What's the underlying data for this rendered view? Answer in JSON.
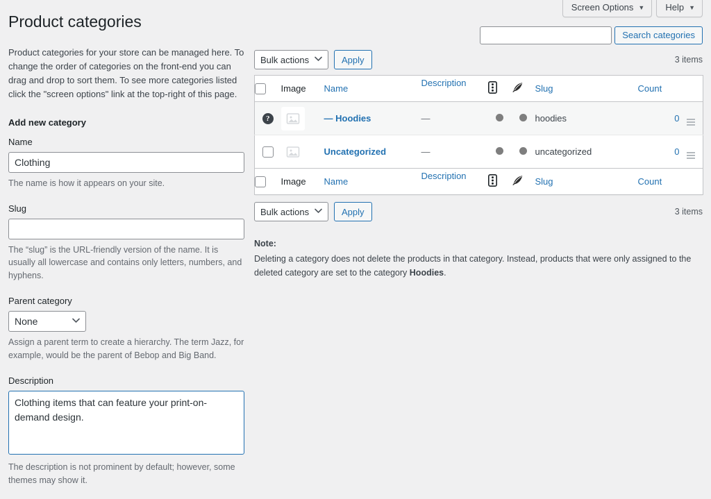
{
  "meta": {
    "screen_options_label": "Screen Options",
    "help_label": "Help",
    "caret_glyph": "▼"
  },
  "header": {
    "page_title": "Product categories"
  },
  "search": {
    "value": "",
    "placeholder": "",
    "button_label": "Search categories"
  },
  "intro": {
    "text": "Product categories for your store can be managed here. To change the order of categories on the front-end you can drag and drop to sort them. To see more categories listed click the \"screen options\" link at the top-right of this page."
  },
  "form": {
    "title": "Add new category",
    "name_label": "Name",
    "name_value": "Clothing",
    "name_help": "The name is how it appears on your site.",
    "slug_label": "Slug",
    "slug_value": "",
    "slug_help": "The “slug” is the URL-friendly version of the name. It is usually all lowercase and contains only letters, numbers, and hyphens.",
    "parent_label": "Parent category",
    "parent_value": "None",
    "parent_options": [
      "None"
    ],
    "parent_help": "Assign a parent term to create a hierarchy. The term Jazz, for example, would be the parent of Bebop and Big Band.",
    "description_label": "Description",
    "description_value": "Clothing items that can feature your print-on-demand design.",
    "description_help": "The description is not prominent by default; however, some themes may show it."
  },
  "tablenav": {
    "bulk_actions_value": "Bulk actions",
    "bulk_actions_options": [
      "Bulk actions"
    ],
    "apply_label": "Apply",
    "items_count": "3 items"
  },
  "table": {
    "columns": {
      "image": "Image",
      "name": "Name",
      "description": "Description",
      "seo_icon": "seo-score-icon",
      "readability_icon": "readability-feather-icon",
      "slug": "Slug",
      "count": "Count"
    },
    "rows": [
      {
        "selector": "help-question-icon",
        "image": "image-placeholder-icon",
        "name": "— Hoodies",
        "description": "—",
        "seo_score": "gray",
        "readability_score": "gray",
        "slug": "hoodies",
        "count": "0",
        "handle": "drag-handle-icon"
      },
      {
        "selector": "row-checkbox",
        "image": "image-placeholder-icon",
        "name": "Uncategorized",
        "description": "—",
        "seo_score": "gray",
        "readability_score": "gray",
        "slug": "uncategorized",
        "count": "0",
        "handle": "drag-handle-icon"
      }
    ]
  },
  "note": {
    "label": "Note:",
    "line1": "Deleting a category does not delete the products in that category. Instead, products that were only assigned to the deleted",
    "line2_pre": "category are set to the category ",
    "line2_bold": "Hoodies",
    "line2_post": "."
  },
  "colors": {
    "link": "#2271b1",
    "page_bg": "#f0f0f1",
    "border": "#c3c4c7",
    "text": "#3c434a",
    "score_dot": "#7e7e7e"
  }
}
